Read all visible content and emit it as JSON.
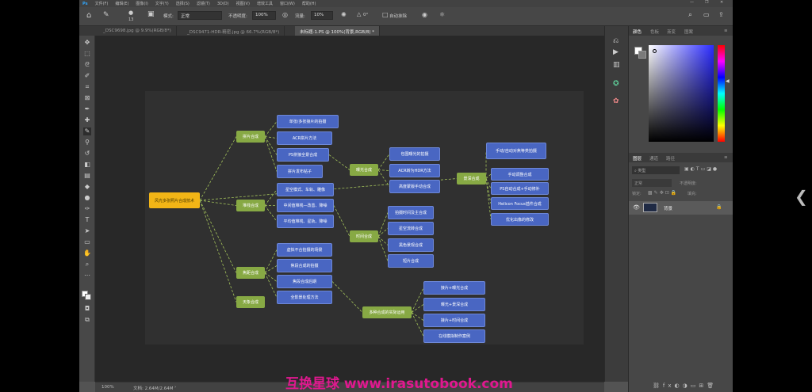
{
  "menu": [
    "文件(F)",
    "编辑(E)",
    "图像(I)",
    "文字(Y)",
    "选择(S)",
    "滤镜(T)",
    "3D(D)",
    "视图(V)",
    "增效工具",
    "窗口(W)",
    "帮助(H)"
  ],
  "options": {
    "mode_label": "模式:",
    "mode_value": "正常",
    "opacity_label": "不透明度:",
    "opacity_value": "100%",
    "flow_label": "流量:",
    "flow_value": "10%",
    "angle_value": "0°",
    "erase_label": "自动抹除",
    "brush_size": "13"
  },
  "tabs": [
    {
      "label": "_DSC9698.jpg @ 9.9%(RGB/8*)"
    },
    {
      "label": "_DSC9471-HDR-精密.jpg @ 66.7%(RGB/8*)"
    },
    {
      "label": "未标题-1.PS @ 100%(背景,RGB/8) *"
    }
  ],
  "mindmap": {
    "root": "风光多张照片合成技术",
    "branch1": "拼片合成",
    "branch1_leaves": [
      "单张/多张接片的拍摄",
      "ACR拼片方法",
      "PS拼接全景合成",
      "拼片发布帖子"
    ],
    "branch2": "堆栈合成",
    "branch2_leaves": [
      "星空模式、车轨、雕像",
      "中间值堆栈—改善、降噪",
      "平均值堆栈、星轨、降噪"
    ],
    "branch3": "焦距合成",
    "branch3_leaves": [
      "虚拟不合拍摄的场景",
      "焦段合成的拍摄",
      "焦段合成后期",
      "全影景处理方法"
    ],
    "branch4": "天象合成",
    "b1_sub": "曝光合成",
    "b1_sub_leaves": [
      "包围曝光的拍摄",
      "ACR转为HDR方法",
      "高度蒙版手动合成"
    ],
    "b1_sub2": "景深合成",
    "b1_sub2_leaves": [
      "手动/自动对焦等类拍摄",
      "手动调整合成",
      "PS自动合成+手动修补",
      "Helicon Focus插件合成",
      "优化出像的修改"
    ],
    "b2_sub": "时间合成",
    "b2_sub_leaves": [
      "拍摄时间及主合成",
      "星空流转合成",
      "黑色景观合成",
      "短片合成"
    ],
    "b3_sub": "多种合成的实际运用",
    "b3_sub_leaves": [
      "接片+曝光合成",
      "曝光+景深合成",
      "接片+时间合成",
      "在线模拟制作案例"
    ]
  },
  "status": {
    "zoom": "100%",
    "doc": "文档: 2.64M/2.64M"
  },
  "panels": {
    "top_tabs": [
      "颜色",
      "色板",
      "渐变",
      "图案"
    ],
    "layer_tabs": [
      "图层",
      "通道",
      "路径"
    ],
    "search_label": "类型",
    "mode_label": "正常",
    "opacity_label": "不透明度:",
    "lock_label": "锁定:",
    "fill_label": "填充:",
    "layer_name": "背景"
  },
  "watermark": "互换星球 www.irasutobook.com",
  "colors": {
    "leaf": "#4966c2",
    "mid": "#87a944",
    "root": "#f2b516",
    "link": "#a3c25a",
    "accent": "#e0188f"
  }
}
